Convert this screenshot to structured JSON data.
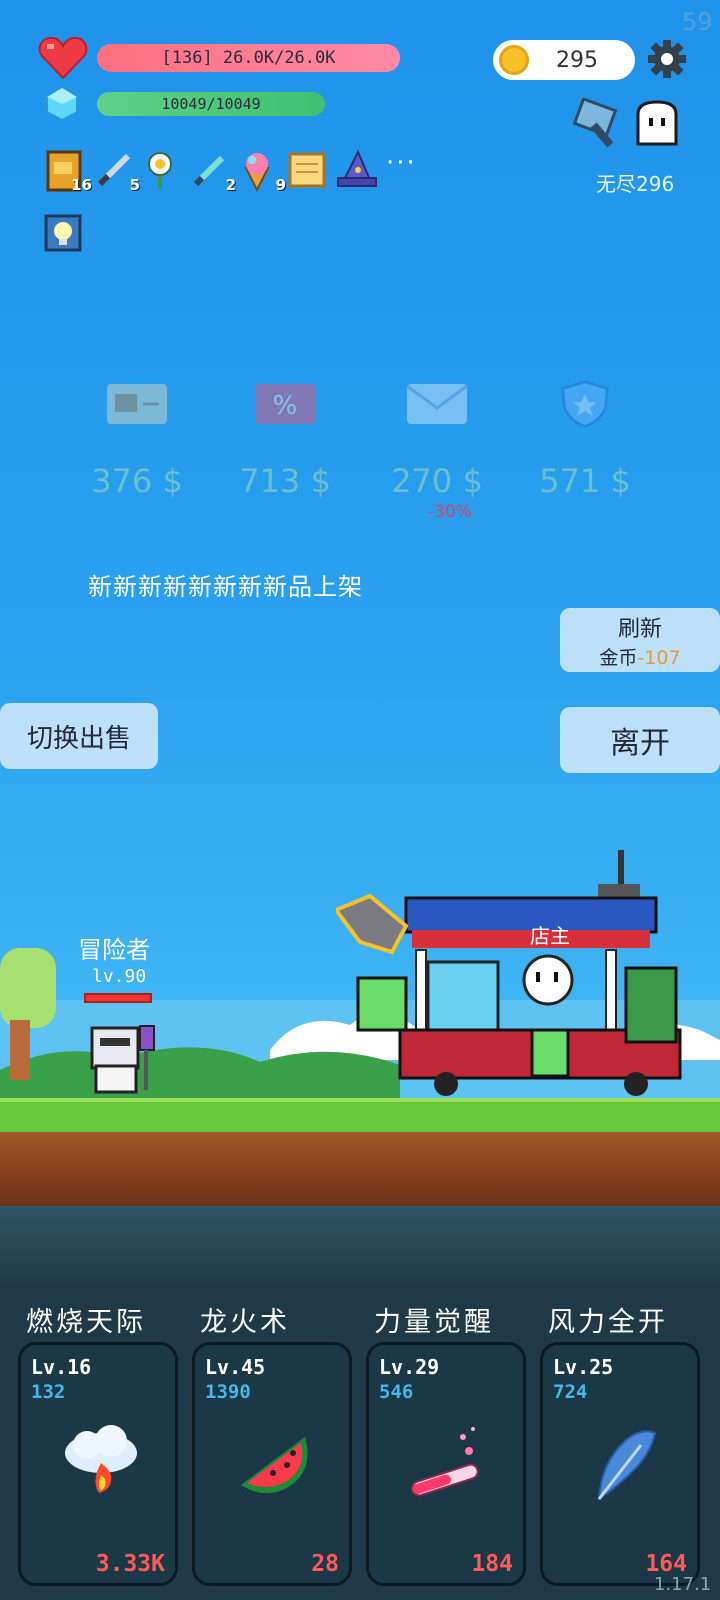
{
  "status": {
    "fps": "59",
    "hp_text": "[136] 26.0K/26.0K",
    "mp_text": "10049/10049",
    "gold": "295",
    "endless_label": "无尽296"
  },
  "inventory": [
    {
      "icon": "book-icon",
      "count": "16"
    },
    {
      "icon": "sword-icon",
      "count": "5"
    },
    {
      "icon": "flower-icon",
      "count": ""
    },
    {
      "icon": "knife-icon",
      "count": "2"
    },
    {
      "icon": "icecream-icon",
      "count": "9"
    },
    {
      "icon": "scroll-icon",
      "count": ""
    },
    {
      "icon": "wizard-hat-icon",
      "count": ""
    }
  ],
  "more_label": "···",
  "shop": {
    "items": [
      {
        "icon": "briefcase-card-icon",
        "price": "376 $"
      },
      {
        "icon": "percent-card-icon",
        "price": "713 $"
      },
      {
        "icon": "envelope-icon",
        "price": "270 $"
      },
      {
        "icon": "shield-star-icon",
        "price": "571 $"
      }
    ],
    "discount": "-30%",
    "restock_text": "新新新新新新新新品上架"
  },
  "buttons": {
    "refresh": "刷新",
    "refresh_cost_label": "金币",
    "refresh_cost_value": "-107",
    "leave": "离开",
    "switch": "切换出售"
  },
  "scene": {
    "adventurer_label": "冒险者",
    "adventurer_level": "lv.90",
    "shopkeeper_label": "店主"
  },
  "skills": [
    {
      "name": "燃烧天际",
      "level": "Lv.16",
      "value": "132",
      "power": "3.33K",
      "icon": "fire-cloud-icon"
    },
    {
      "name": "龙火术",
      "level": "Lv.45",
      "value": "1390",
      "power": "28",
      "icon": "watermelon-icon"
    },
    {
      "name": "力量觉醒",
      "level": "Lv.29",
      "value": "546",
      "power": "184",
      "icon": "potion-tube-icon"
    },
    {
      "name": "风力全开",
      "level": "Lv.25",
      "value": "724",
      "power": "164",
      "icon": "feather-icon"
    }
  ],
  "version": "1.17.1",
  "colors": {
    "sky": "#2aa0ee",
    "hp": "#ff7a90",
    "mp": "#4cc87a",
    "gold": "#f7c12a",
    "grass": "#66c83a",
    "card_bg": "#1b3846",
    "power": "#ff5a5a",
    "sub_value": "#45b8ec"
  }
}
